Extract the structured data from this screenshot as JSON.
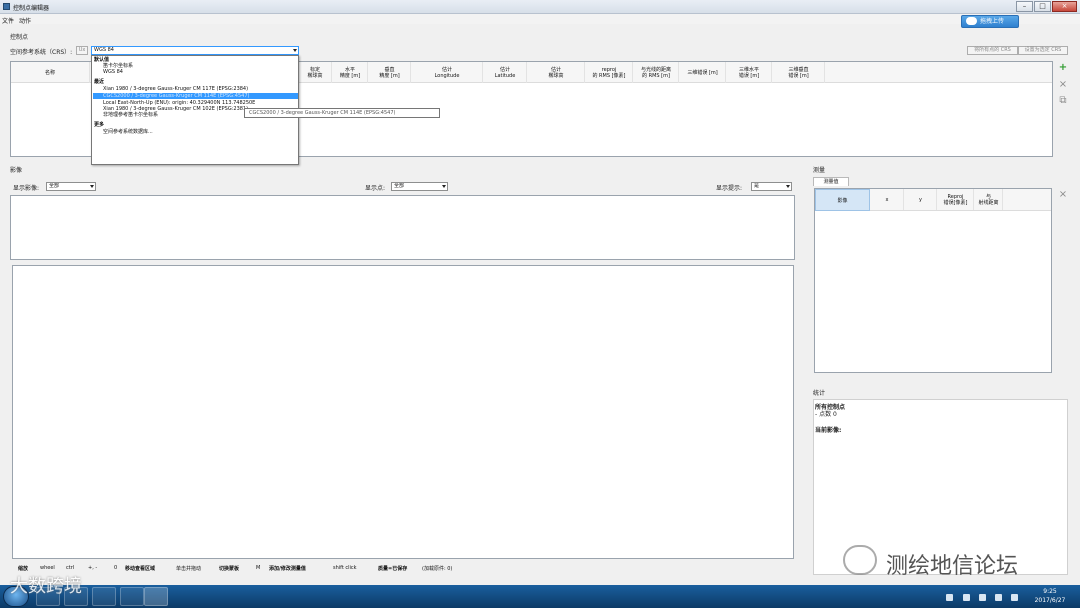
{
  "window": {
    "title": "控制点编辑器"
  },
  "menu": [
    "文件",
    "动作"
  ],
  "cloud_button": "拖拽上传",
  "section_control_points": "控制点",
  "crs": {
    "label": "空间参考系统（CRS）:",
    "value": "WGS 84",
    "info_btn": "Ux"
  },
  "top_right_buttons": [
    "将所有点的 CRS",
    "设置为选定 CRS"
  ],
  "table_headers": [
    "名称",
    "经度",
    "纬度",
    "椭球高",
    "标定\n椭球高",
    "水平\n精度 [m]",
    "垂直\n精度 [m]",
    "估计\nLongitude",
    "估计\nLatitude",
    "估计\n椭球高",
    "reproj\n的 RMS [像素]",
    "描误\n[像素]",
    "与光线的距离\n的 RMS [m]",
    "三维错误 [m]",
    "三维水平\n错误 [m]",
    "三维垂直\n错误 [m]"
  ],
  "crs_dropdown": [
    {
      "text": "默认值",
      "type": "header"
    },
    {
      "text": "笛卡尔坐标系",
      "type": "item"
    },
    {
      "text": "WGS 84",
      "type": "item"
    },
    {
      "text": "最近",
      "type": "header"
    },
    {
      "text": "Xian 1980 / 3-degree Gauss-Kruger CM 117E (EPSG:2384)",
      "type": "item"
    },
    {
      "text": "CGCS2000 / 3-degree Gauss-Kruger CM 114E (EPSG:4547)",
      "type": "selected"
    },
    {
      "text": "Local East-North-Up (ENU): origin: 40.329400N 113.748250E",
      "type": "item"
    },
    {
      "text": "Xian 1980 / 3-degree Gauss-Kruger CM 102E (EPSG:2381)",
      "type": "item"
    },
    {
      "text": "非地理参考笛卡尔坐标系",
      "type": "item"
    },
    {
      "text": "更多",
      "type": "header"
    },
    {
      "text": "空间参考系统数据库...",
      "type": "item"
    }
  ],
  "tooltip": "CGCS2000 / 3-degree Gauss-Kruger CM 114E (EPSG:4547)",
  "section_images": "影像",
  "filters": {
    "show_images_label": "显示影像:",
    "show_images_value": "全部",
    "show_points_label": "显示点:",
    "show_points_value": "全部",
    "show_hints_label": "显示提示:",
    "show_hints_value": "是"
  },
  "measurements": {
    "section": "测量",
    "tab": "测量值",
    "headers": [
      "影像",
      "x",
      "y",
      "Reproj\n错误[像素]",
      "与\n射线距离"
    ]
  },
  "stats": {
    "section": "统计",
    "all_points": "所有控制点",
    "point_count": "- 点数  0",
    "current_image": "当前影像:"
  },
  "statusbar": [
    "缩放",
    "wheel",
    "ctrl",
    "+, -",
    "0",
    "移动查看区域",
    "单击并拖动",
    "切换蒙板",
    "M",
    "添加/修改测量值",
    "shift click",
    "质量=已保存",
    "(加载原件: 0)"
  ],
  "clock": {
    "time": "9:25",
    "date": "2017/6/27"
  },
  "watermarks": {
    "left": "大数跨境",
    "right": "测绘地信论坛"
  }
}
